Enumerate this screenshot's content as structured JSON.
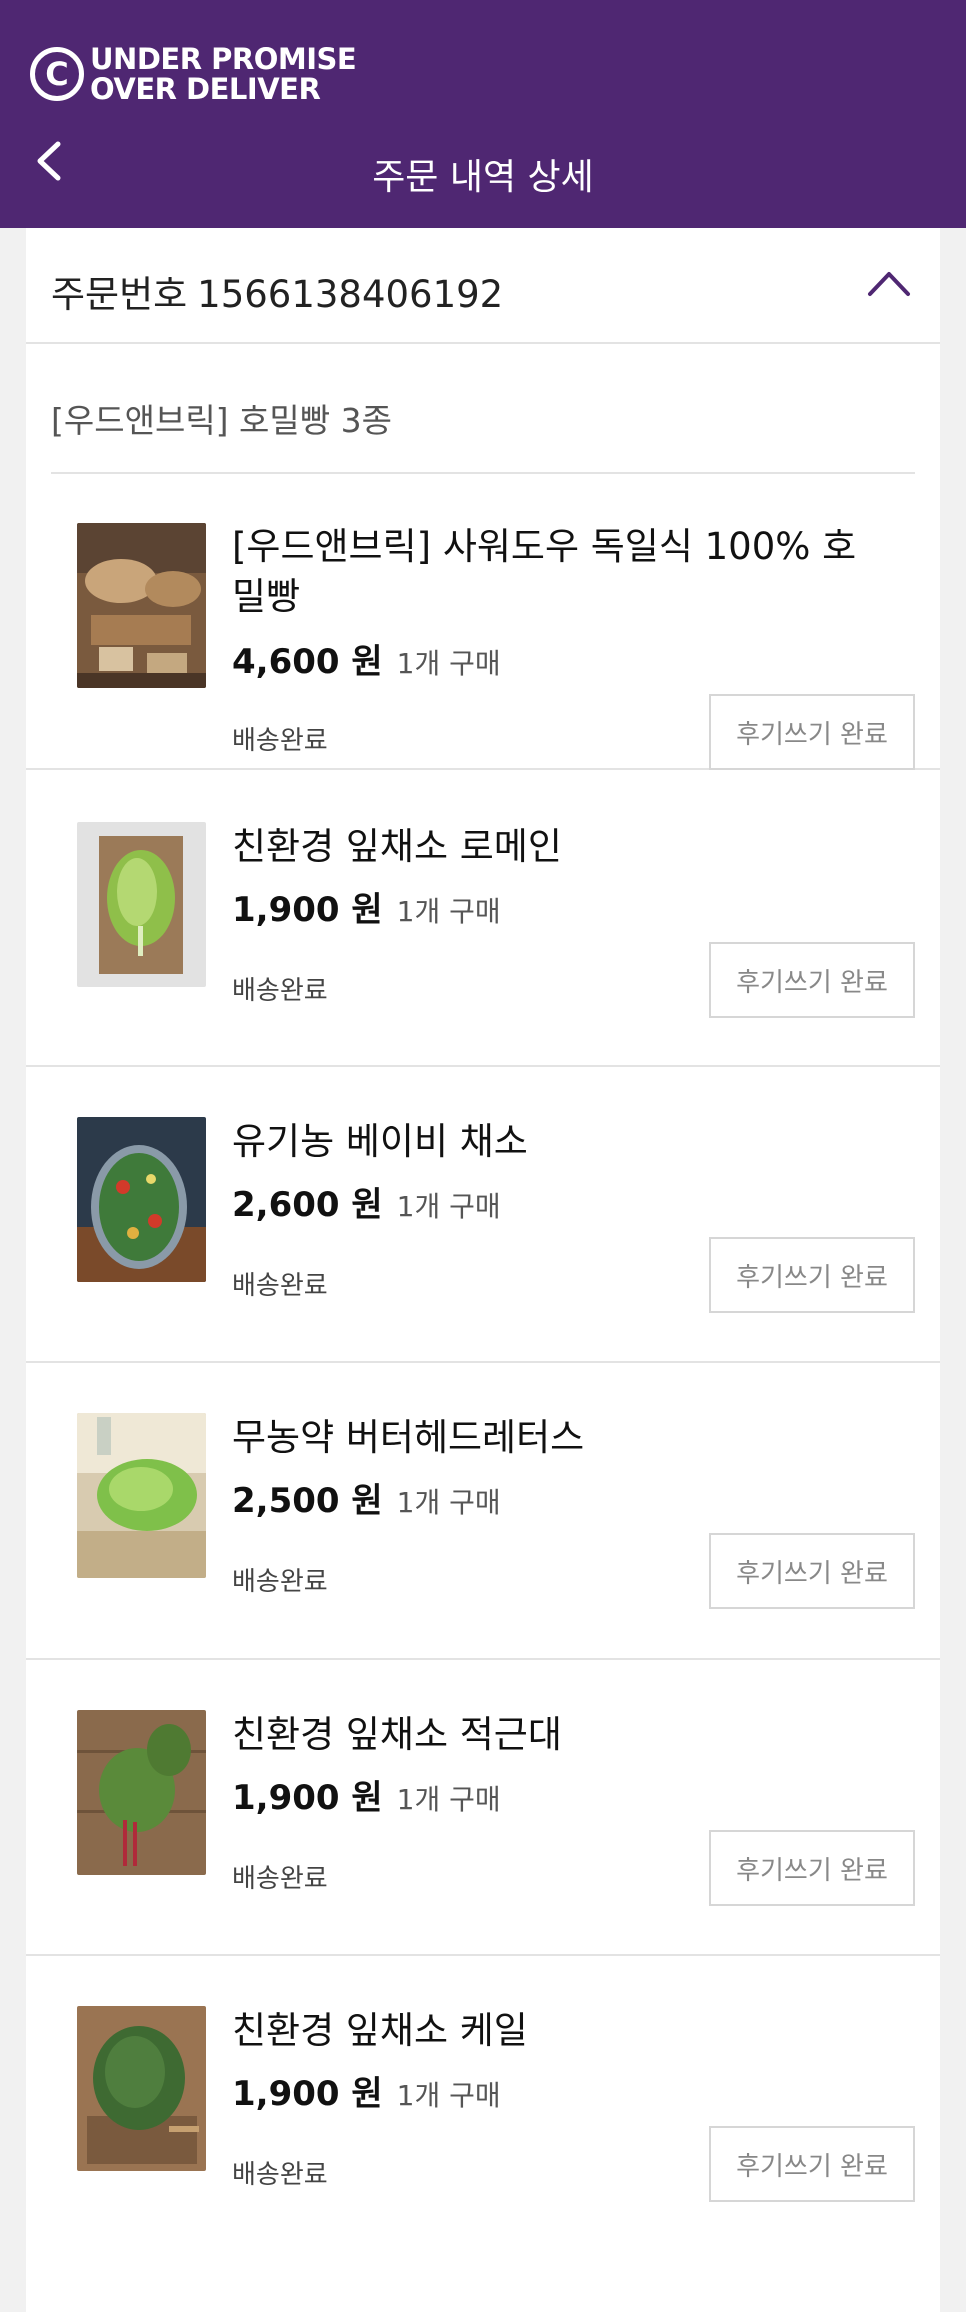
{
  "brand": {
    "logo_letter": "C",
    "line1": "UNDER PROMISE",
    "line2": "OVER DELIVER",
    "color": "#4f2772"
  },
  "header": {
    "title": "주문 내역 상세",
    "back_icon": "chevron-left-icon"
  },
  "order": {
    "label": "주문번호",
    "number": "1566138406192",
    "toggle_icon": "chevron-up-icon"
  },
  "shop": {
    "title": "[우드앤브릭] 호밀빵 3종"
  },
  "items": [
    {
      "name": "[우드앤브릭] 사워도우 독일식 100% 호밀빵",
      "price": "4,600 원",
      "qty": "1개 구매",
      "status": "배송완료",
      "review": "후기쓰기 완료",
      "image": "rye-bread-photo"
    },
    {
      "name": "친환경 잎채소 로메인",
      "price": "1,900 원",
      "qty": "1개 구매",
      "status": "배송완료",
      "review": "후기쓰기 완료",
      "image": "romaine-photo"
    },
    {
      "name": "유기농 베이비 채소",
      "price": "2,600 원",
      "qty": "1개 구매",
      "status": "배송완료",
      "review": "후기쓰기 완료",
      "image": "baby-greens-photo"
    },
    {
      "name": "무농약 버터헤드레터스",
      "price": "2,500 원",
      "qty": "1개 구매",
      "status": "배송완료",
      "review": "후기쓰기 완료",
      "image": "butterhead-photo"
    },
    {
      "name": "친환경 잎채소 적근대",
      "price": "1,900 원",
      "qty": "1개 구매",
      "status": "배송완료",
      "review": "후기쓰기 완료",
      "image": "chard-photo"
    },
    {
      "name": "친환경 잎채소 케일",
      "price": "1,900 원",
      "qty": "1개 구매",
      "status": "배송완료",
      "review": "후기쓰기 완료",
      "image": "kale-photo"
    }
  ]
}
